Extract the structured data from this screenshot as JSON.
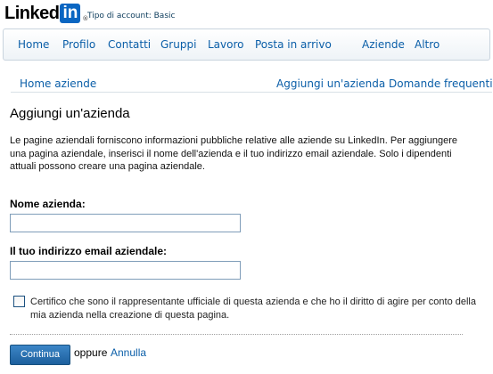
{
  "header": {
    "logo_text": "Linked",
    "logo_in": "in",
    "logo_reg": "®",
    "account_type": "Tipo di account: Basic"
  },
  "nav": {
    "items": [
      "Home",
      "Profilo",
      "Contatti",
      "Gruppi",
      "Lavoro",
      "Posta in arrivo",
      "Aziende",
      "Altro"
    ]
  },
  "subnav": {
    "home": "Home aziende",
    "add": "Aggiungi un'azienda",
    "faq": "Domande frequenti"
  },
  "main": {
    "title": "Aggiungi un'azienda",
    "intro": "Le pagine aziendali forniscono informazioni pubbliche relative alle aziende su LinkedIn. Per aggiungere una pagina aziendale, inserisci il nome dell'azienda e il tuo indirizzo email aziendale. Solo i dipendenti attuali possono creare una pagina aziendale.",
    "company_name_label": "Nome azienda:",
    "company_name_value": "",
    "email_label": "Il tuo indirizzo email aziendale:",
    "email_value": "",
    "certify_text": "Certifico che sono il rappresentante ufficiale di questa azienda e che ho il diritto di agire per conto della mia azienda nella creazione di questa pagina.",
    "continue_label": "Continua",
    "or_label": "oppure",
    "cancel_label": "Annulla"
  }
}
